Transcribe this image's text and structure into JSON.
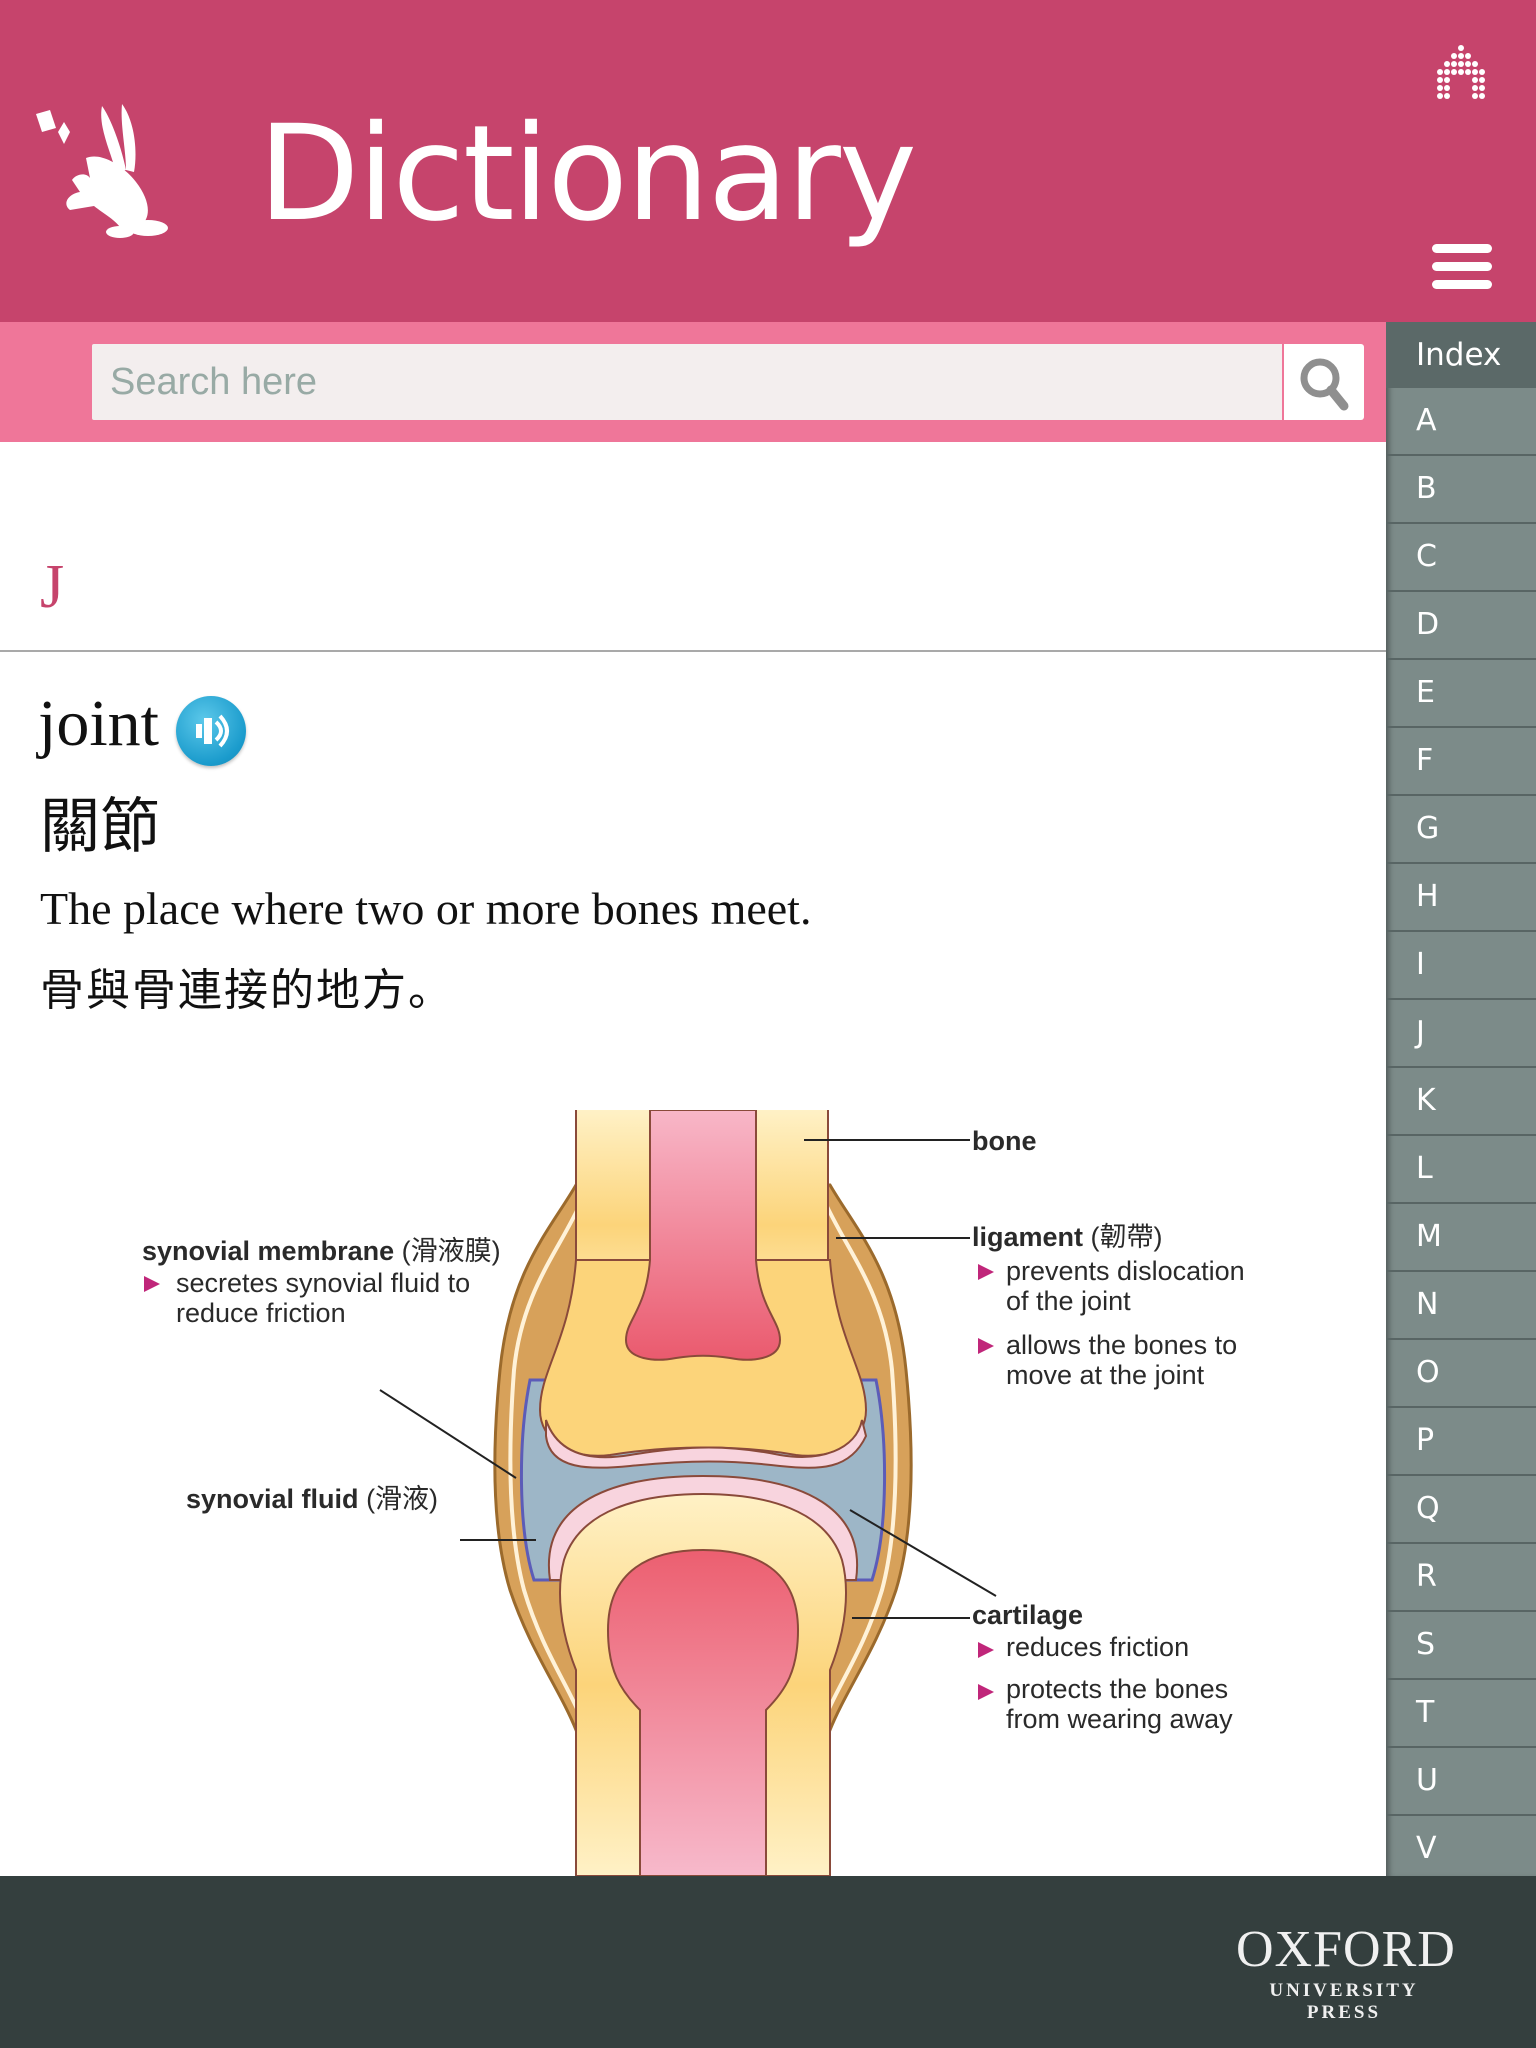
{
  "header": {
    "title": "Dictionary",
    "logo_icon": "rabbit-logo-icon",
    "home_icon": "home-icon",
    "menu_icon": "hamburger-menu-icon",
    "background_color": "#c6446c"
  },
  "search": {
    "placeholder": "Search here",
    "value": "",
    "button_icon": "magnifier-icon",
    "bar_color": "#ef7699"
  },
  "index": {
    "title": "Index",
    "letters": [
      "A",
      "B",
      "C",
      "D",
      "E",
      "F",
      "G",
      "H",
      "I",
      "J",
      "K",
      "L",
      "M",
      "N",
      "O",
      "P",
      "Q",
      "R",
      "S",
      "T",
      "U",
      "V"
    ],
    "panel_color": "#7c8b89"
  },
  "entry": {
    "section_letter": "J",
    "headword": "joint",
    "audio_icon": "speaker-audio-icon",
    "chinese": "關節",
    "definition_en": "The place where two or more bones meet.",
    "definition_zh": "骨與骨連接的地方。"
  },
  "diagram": {
    "labels": {
      "bone": "bone",
      "ligament_title": "ligament",
      "ligament_zh": "(韌帶)",
      "ligament_points": [
        [
          "prevents dislocation",
          "of the joint"
        ],
        [
          "allows the bones to",
          "move at the joint"
        ]
      ],
      "membrane_title": "synovial membrane",
      "membrane_zh": "(滑液膜)",
      "membrane_points": [
        [
          "secretes synovial fluid to",
          "reduce friction"
        ]
      ],
      "fluid_title": "synovial fluid",
      "fluid_zh": "(滑液)",
      "cartilage_title": "cartilage",
      "cartilage_points": [
        [
          "reduces friction"
        ],
        [
          "protects the bones",
          "from wearing away"
        ]
      ]
    },
    "bullet_color": "#c0267a"
  },
  "footer": {
    "publisher_name": "OXFORD",
    "publisher_sub": "UNIVERSITY PRESS",
    "background_color": "#343f3e"
  }
}
